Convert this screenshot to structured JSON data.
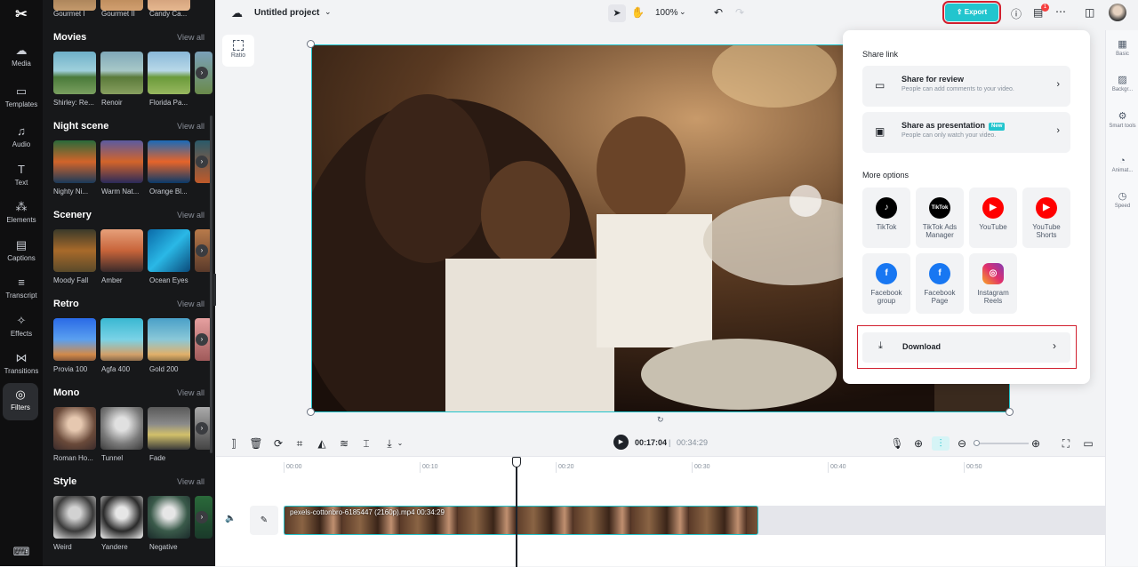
{
  "rail": {
    "items": [
      {
        "label": "Media",
        "icon": "cloud-upload-icon"
      },
      {
        "label": "Templates",
        "icon": "templates-icon"
      },
      {
        "label": "Audio",
        "icon": "music-note-icon"
      },
      {
        "label": "Text",
        "icon": "text-icon"
      },
      {
        "label": "Elements",
        "icon": "elements-icon"
      },
      {
        "label": "Captions",
        "icon": "captions-icon"
      },
      {
        "label": "Transcript",
        "icon": "transcript-icon"
      },
      {
        "label": "Effects",
        "icon": "sparkle-icon"
      },
      {
        "label": "Transitions",
        "icon": "transition-icon"
      },
      {
        "label": "Filters",
        "icon": "filters-icon"
      }
    ],
    "active": "Filters"
  },
  "panel": {
    "top_row": [
      "Gourmet I",
      "Gourmet II",
      "Candy Ca..."
    ],
    "view_all": "View all",
    "categories": [
      {
        "title": "Movies",
        "items": [
          "Shirley: Re...",
          "Renoir",
          "Florida Pa..."
        ]
      },
      {
        "title": "Night scene",
        "items": [
          "Nighty Ni...",
          "Warm Nat...",
          "Orange Bl..."
        ]
      },
      {
        "title": "Scenery",
        "items": [
          "Moody Fall",
          "Amber",
          "Ocean Eyes"
        ]
      },
      {
        "title": "Retro",
        "items": [
          "Provia 100",
          "Agfa 400",
          "Gold 200"
        ]
      },
      {
        "title": "Mono",
        "items": [
          "Roman Ho...",
          "Tunnel",
          "Fade"
        ]
      },
      {
        "title": "Style",
        "items": [
          "Weird",
          "Yandere",
          "Negative"
        ]
      }
    ]
  },
  "topbar": {
    "project_title": "Untitled project",
    "zoom": "100%",
    "export_label": "Export",
    "notification_count": "1"
  },
  "canvas": {
    "ratio_label": "Ratio"
  },
  "right_tools": [
    {
      "label": "Basic"
    },
    {
      "label": "Backgr..."
    },
    {
      "label": "Smart tools"
    },
    {
      "label": "Animat..."
    },
    {
      "label": "Speed"
    }
  ],
  "share": {
    "share_link_title": "Share link",
    "review_title": "Share for review",
    "review_sub": "People can add comments to your video.",
    "presentation_title": "Share as presentation",
    "presentation_badge": "New",
    "presentation_sub": "People can only watch your video.",
    "more_options_title": "More options",
    "options": [
      {
        "name": "TikTok",
        "color": "#000000"
      },
      {
        "name": "TikTok Ads Manager",
        "color": "#000000"
      },
      {
        "name": "YouTube",
        "color": "#ff0000"
      },
      {
        "name": "YouTube Shorts",
        "color": "#ff0000"
      },
      {
        "name": "Facebook group",
        "color": "#1877f2"
      },
      {
        "name": "Facebook Page",
        "color": "#1877f2"
      },
      {
        "name": "Instagram Reels",
        "color": "#e1306c"
      }
    ],
    "download_label": "Download"
  },
  "playback": {
    "current_time": "00:17:04",
    "separator": "|",
    "total_time": "00:34:29"
  },
  "timeline": {
    "ticks": [
      "00:00",
      "00:10",
      "00:20",
      "00:30",
      "00:40",
      "00:50"
    ],
    "clip_label": "pexels-cottonbro-6185447 (2160p).mp4   00:34:29"
  },
  "colors": {
    "accent": "#22c5ce",
    "highlight_outline": "#d11f2e"
  }
}
